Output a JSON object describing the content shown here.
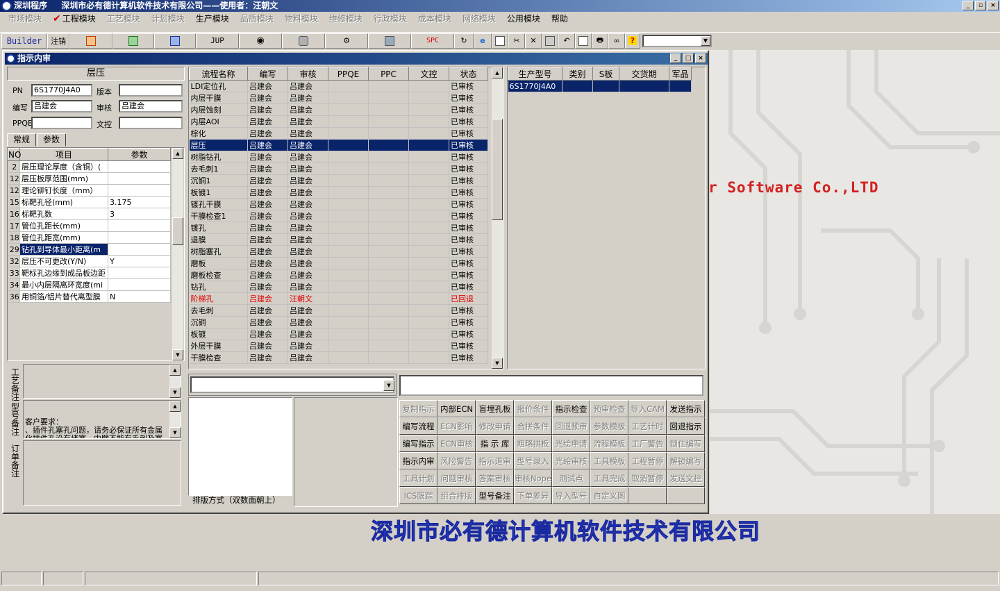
{
  "app": {
    "title": "深圳程序",
    "company_user": "深圳市必有德计算机软件技术有限公司——使用者：汪朝文"
  },
  "menu": [
    {
      "label": "市场模块",
      "enabled": false
    },
    {
      "label": "工程模块",
      "enabled": true,
      "checked": true
    },
    {
      "label": "工艺模块",
      "enabled": false
    },
    {
      "label": "计划模块",
      "enabled": false
    },
    {
      "label": "生产模块",
      "enabled": true
    },
    {
      "label": "品质模块",
      "enabled": false
    },
    {
      "label": "物料模块",
      "enabled": false
    },
    {
      "label": "维修模块",
      "enabled": false
    },
    {
      "label": "行政模块",
      "enabled": false
    },
    {
      "label": "成本模块",
      "enabled": false
    },
    {
      "label": "网络模块",
      "enabled": false
    },
    {
      "label": "公用模块",
      "enabled": true
    },
    {
      "label": "帮助",
      "enabled": true
    }
  ],
  "toolbar": {
    "builder": "Builder",
    "logout": "注销",
    "jup": "JUP",
    "spc": "SPC",
    "combo_value": ""
  },
  "background": {
    "slogan": "r Software Co.,LTD",
    "company": "深圳市必有德计算机软件技术有限公司"
  },
  "window": {
    "title": "指示内审"
  },
  "left": {
    "section_title": "层压",
    "pn_label": "PN",
    "pn_value": "6S1770J4A0",
    "version_label": "版本",
    "version_value": "",
    "author_label": "编写",
    "author_value": "吕建会",
    "review_label": "审核",
    "review_value": "吕建会",
    "ppqe_label": "PPQE",
    "ppqe_value": "",
    "wenkong_label": "文控",
    "wenkong_value": "",
    "tabs": [
      "常规",
      "参数"
    ],
    "param_headers": [
      "NO",
      "项目",
      "参数"
    ],
    "params": [
      [
        "2",
        "层压理论厚度（含铜）(",
        ""
      ],
      [
        "12",
        "层压板厚范围(mm)",
        ""
      ],
      [
        "12",
        "理论铆钉长度（mm）",
        ""
      ],
      [
        "15",
        "标靶孔径(mm)",
        "3.175"
      ],
      [
        "16",
        "标靶孔数",
        "3"
      ],
      [
        "17",
        "管位孔距长(mm)",
        ""
      ],
      [
        "18",
        "管位孔距宽(mm)",
        ""
      ],
      [
        "29",
        "钻孔到导体最小距离(m",
        ""
      ],
      [
        "32",
        "层压不可更改(Y/N)",
        "Y"
      ],
      [
        "33",
        "靶标孔边缘到成品板边距",
        ""
      ],
      [
        "34",
        "最小内层隔离环宽度(mi",
        ""
      ],
      [
        "36",
        "用铜箔/铝片替代离型膜",
        "N"
      ]
    ],
    "selected_param": 7,
    "process_note_label": "工艺备注",
    "model_note_label": "型号备注",
    "model_note": "客户要求：\n、插件孔塞孔问题，请务必保证所有金属化插件孔没有堵塞，内壁不能有毛刺及塞住现象",
    "order_note_label": "订单备注"
  },
  "flow": {
    "headers": [
      "流程名称",
      "编写",
      "审核",
      "PPQE",
      "PPC",
      "文控",
      "状态"
    ],
    "rows": [
      [
        "LDI定位孔",
        "吕建会",
        "吕建会",
        "",
        "",
        "",
        "已审核"
      ],
      [
        "内层干膜",
        "吕建会",
        "吕建会",
        "",
        "",
        "",
        "已审核"
      ],
      [
        "内层蚀刻",
        "吕建会",
        "吕建会",
        "",
        "",
        "",
        "已审核"
      ],
      [
        "内层AOI",
        "吕建会",
        "吕建会",
        "",
        "",
        "",
        "已审核"
      ],
      [
        "棕化",
        "吕建会",
        "吕建会",
        "",
        "",
        "",
        "已审核"
      ],
      [
        "层压",
        "吕建会",
        "吕建会",
        "",
        "",
        "",
        "已审核"
      ],
      [
        "树脂钻孔",
        "吕建会",
        "吕建会",
        "",
        "",
        "",
        "已审核"
      ],
      [
        "去毛刺1",
        "吕建会",
        "吕建会",
        "",
        "",
        "",
        "已审核"
      ],
      [
        "沉铜1",
        "吕建会",
        "吕建会",
        "",
        "",
        "",
        "已审核"
      ],
      [
        "板镀1",
        "吕建会",
        "吕建会",
        "",
        "",
        "",
        "已审核"
      ],
      [
        "镀孔干膜",
        "吕建会",
        "吕建会",
        "",
        "",
        "",
        "已审核"
      ],
      [
        "干膜检查1",
        "吕建会",
        "吕建会",
        "",
        "",
        "",
        "已审核"
      ],
      [
        "镀孔",
        "吕建会",
        "吕建会",
        "",
        "",
        "",
        "已审核"
      ],
      [
        "退膜",
        "吕建会",
        "吕建会",
        "",
        "",
        "",
        "已审核"
      ],
      [
        "树脂塞孔",
        "吕建会",
        "吕建会",
        "",
        "",
        "",
        "已审核"
      ],
      [
        "磨板",
        "吕建会",
        "吕建会",
        "",
        "",
        "",
        "已审核"
      ],
      [
        "磨板检查",
        "吕建会",
        "吕建会",
        "",
        "",
        "",
        "已审核"
      ],
      [
        "钻孔",
        "吕建会",
        "吕建会",
        "",
        "",
        "",
        "已审核"
      ],
      [
        "阶梯孔",
        "吕建会",
        "汪朝文",
        "",
        "",
        "",
        "已回退"
      ],
      [
        "去毛刺",
        "吕建会",
        "吕建会",
        "",
        "",
        "",
        "已审核"
      ],
      [
        "沉铜",
        "吕建会",
        "吕建会",
        "",
        "",
        "",
        "已审核"
      ],
      [
        "板镀",
        "吕建会",
        "吕建会",
        "",
        "",
        "",
        "已审核"
      ],
      [
        "外层干膜",
        "吕建会",
        "吕建会",
        "",
        "",
        "",
        "已审核"
      ],
      [
        "干膜检查",
        "吕建会",
        "吕建会",
        "",
        "",
        "",
        "已审核"
      ]
    ],
    "selected": 5,
    "returned": 18
  },
  "model": {
    "headers": [
      "生产型号",
      "类别",
      "S板",
      "交货期",
      "军品"
    ],
    "rows": [
      [
        "6S1770J4A0",
        "",
        "",
        "",
        ""
      ]
    ]
  },
  "bottom": {
    "layout_label": "排版方式（双数面朝上）",
    "combo_value": "",
    "input_value": ""
  },
  "buttons": [
    {
      "label": "复制指示",
      "enabled": false
    },
    {
      "label": "内部ECN",
      "enabled": true
    },
    {
      "label": "盲埋孔板",
      "enabled": true
    },
    {
      "label": "报价条件",
      "enabled": false
    },
    {
      "label": "指示检查",
      "enabled": true
    },
    {
      "label": "预审检查",
      "enabled": false
    },
    {
      "label": "导入CAM",
      "enabled": false
    },
    {
      "label": "发送指示",
      "enabled": true
    },
    {
      "label": "编写流程",
      "enabled": true
    },
    {
      "label": "ECN影响",
      "enabled": false
    },
    {
      "label": "修改申请",
      "enabled": false
    },
    {
      "label": "合拼条件",
      "enabled": false
    },
    {
      "label": "回退预审",
      "enabled": false
    },
    {
      "label": "参数模板",
      "enabled": false
    },
    {
      "label": "工艺计时",
      "enabled": false
    },
    {
      "label": "回退指示",
      "enabled": true
    },
    {
      "label": "编写指示",
      "enabled": true
    },
    {
      "label": "ECN审核",
      "enabled": false
    },
    {
      "label": "指 示 库",
      "enabled": true
    },
    {
      "label": "粗略拼板",
      "enabled": false
    },
    {
      "label": "光绘申请",
      "enabled": false
    },
    {
      "label": "流程模板",
      "enabled": false
    },
    {
      "label": "工厂警告",
      "enabled": false
    },
    {
      "label": "锁住编写",
      "enabled": false
    },
    {
      "label": "指示内审",
      "enabled": true
    },
    {
      "label": "风险警告",
      "enabled": false
    },
    {
      "label": "指示退审",
      "enabled": false
    },
    {
      "label": "型号录入",
      "enabled": false
    },
    {
      "label": "光绘审核",
      "enabled": false
    },
    {
      "label": "工具模板",
      "enabled": false
    },
    {
      "label": "工程暂停",
      "enabled": false
    },
    {
      "label": "解锁编写",
      "enabled": false
    },
    {
      "label": "工具计划",
      "enabled": false
    },
    {
      "label": "问题审核",
      "enabled": false
    },
    {
      "label": "答案审核",
      "enabled": false
    },
    {
      "label": "审核Nope",
      "enabled": false
    },
    {
      "label": "测试点",
      "enabled": false
    },
    {
      "label": "工具完成",
      "enabled": false
    },
    {
      "label": "取消暂停",
      "enabled": false
    },
    {
      "label": "发送文控",
      "enabled": false
    },
    {
      "label": "ICS跟踪",
      "enabled": false
    },
    {
      "label": "组合排版",
      "enabled": false
    },
    {
      "label": "型号备注",
      "enabled": true
    },
    {
      "label": "下单差异",
      "enabled": false
    },
    {
      "label": "导入型号",
      "enabled": false
    },
    {
      "label": "自定义图",
      "enabled": false
    },
    {
      "label": "",
      "enabled": false
    },
    {
      "label": "",
      "enabled": false
    }
  ],
  "colors": {
    "title_start": "#0a246a",
    "selection": "#0a246a",
    "returned_row": "#e00000",
    "slogan": "#d42020",
    "company": "#3a4ad8"
  }
}
